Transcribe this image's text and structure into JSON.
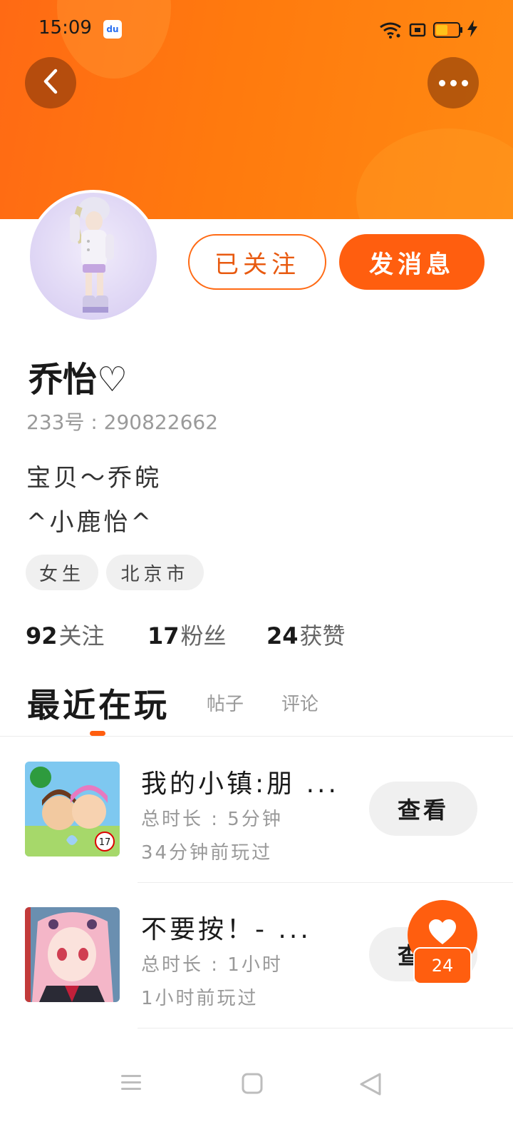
{
  "status_bar": {
    "time": "15:09",
    "app_icon_text": "du",
    "battery_level": 0.6
  },
  "profile": {
    "follow_label": "已关注",
    "message_label": "发消息",
    "name": "乔怡♡",
    "id_text": "233号 : 290822662",
    "bio_lines": [
      "宝贝～乔皖",
      "^小鹿怡^"
    ],
    "tags": [
      "女生",
      "北京市"
    ],
    "stats": [
      {
        "value": "92",
        "label": "关注"
      },
      {
        "value": "17",
        "label": "粉丝"
      },
      {
        "value": "24",
        "label": "获赞"
      }
    ]
  },
  "tabs": [
    {
      "label": "最近在玩",
      "active": true
    },
    {
      "label": "帖子",
      "active": false
    },
    {
      "label": "评论",
      "active": false
    }
  ],
  "games": [
    {
      "title": "我的小镇:朋 ...",
      "duration": "总时长 : 5分钟",
      "last_played": "34分钟前玩过",
      "button": "查看",
      "thumb_badge": "17"
    },
    {
      "title": "不要按！- ...",
      "duration": "总时长 : 1小时",
      "last_played": "1小时前玩过",
      "button": "查看"
    }
  ],
  "like_fab": {
    "count": "24"
  },
  "colors": {
    "accent": "#ff5e0f",
    "header": "#ff7a0e"
  },
  "icons": {
    "back": "chevron-left-icon",
    "more": "more-dots-icon",
    "like": "heart-icon",
    "nav": [
      "menu-icon",
      "home-square-icon",
      "back-triangle-icon"
    ]
  }
}
